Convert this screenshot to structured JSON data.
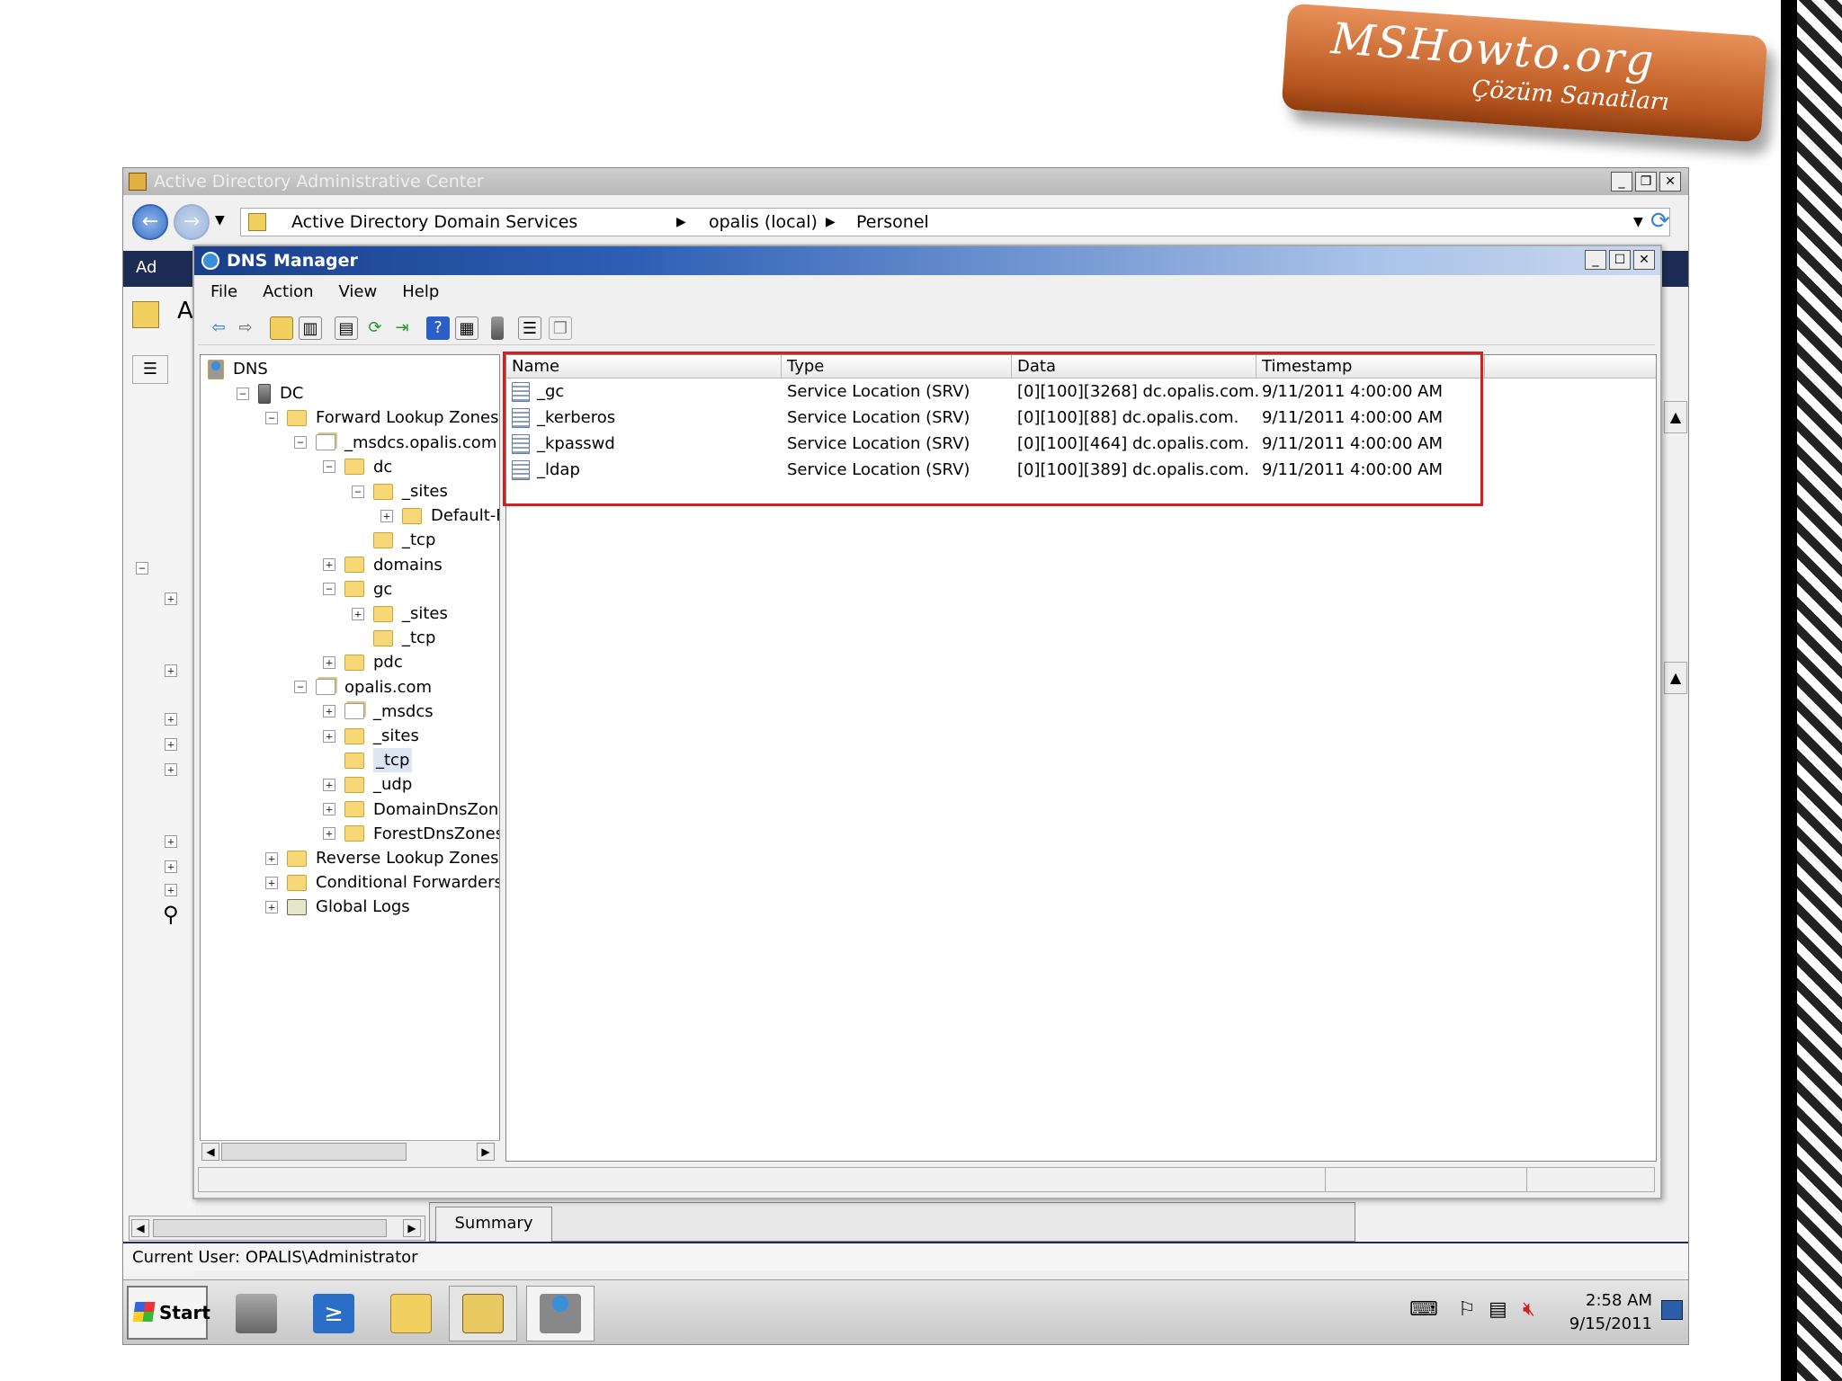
{
  "logo": {
    "title": "MSHowto.org",
    "subtitle": "Çözüm Sanatları"
  },
  "adac": {
    "window_title": "Active Directory Administrative Center",
    "breadcrumb": [
      "Active Directory Domain Services",
      "opalis (local)",
      "Personel"
    ],
    "side_label_1": "Ad",
    "side_label_2": "A",
    "summary_tab": "Summary",
    "current_user": "Current User: OPALIS\\Administrator"
  },
  "dns": {
    "window_title": "DNS Manager",
    "menu": [
      "File",
      "Action",
      "View",
      "Help"
    ],
    "tree": [
      {
        "label": "DNS",
        "level": 0,
        "icon": "dns-server-icon",
        "exp": ""
      },
      {
        "label": "DC",
        "level": 1,
        "icon": "server-icon",
        "exp": "−"
      },
      {
        "label": "Forward Lookup Zones",
        "level": 2,
        "icon": "folder-icon",
        "exp": "−"
      },
      {
        "label": "_msdcs.opalis.com",
        "level": 3,
        "icon": "zone-icon",
        "exp": "−"
      },
      {
        "label": "dc",
        "level": 4,
        "icon": "folder-icon",
        "exp": "−"
      },
      {
        "label": "_sites",
        "level": 5,
        "icon": "folder-icon",
        "exp": "−"
      },
      {
        "label": "Default-Firs",
        "level": 6,
        "icon": "folder-icon",
        "exp": "+"
      },
      {
        "label": "_tcp",
        "level": 5,
        "icon": "folder-icon",
        "exp": " "
      },
      {
        "label": "domains",
        "level": 4,
        "icon": "folder-icon",
        "exp": "+"
      },
      {
        "label": "gc",
        "level": 4,
        "icon": "folder-icon",
        "exp": "−"
      },
      {
        "label": "_sites",
        "level": 5,
        "icon": "folder-icon",
        "exp": "+"
      },
      {
        "label": "_tcp",
        "level": 5,
        "icon": "folder-icon",
        "exp": " "
      },
      {
        "label": "pdc",
        "level": 4,
        "icon": "folder-icon",
        "exp": "+"
      },
      {
        "label": "opalis.com",
        "level": 3,
        "icon": "zone-icon",
        "exp": "−"
      },
      {
        "label": "_msdcs",
        "level": 4,
        "icon": "zone-icon",
        "exp": "+"
      },
      {
        "label": "_sites",
        "level": 4,
        "icon": "folder-icon",
        "exp": "+"
      },
      {
        "label": "_tcp",
        "level": 4,
        "icon": "folder-icon",
        "exp": " ",
        "selected": true
      },
      {
        "label": "_udp",
        "level": 4,
        "icon": "folder-icon",
        "exp": "+"
      },
      {
        "label": "DomainDnsZones",
        "level": 4,
        "icon": "folder-icon",
        "exp": "+"
      },
      {
        "label": "ForestDnsZones",
        "level": 4,
        "icon": "folder-icon",
        "exp": "+"
      },
      {
        "label": "Reverse Lookup Zones",
        "level": 2,
        "icon": "folder-icon",
        "exp": "+"
      },
      {
        "label": "Conditional Forwarders",
        "level": 2,
        "icon": "folder-icon",
        "exp": "+"
      },
      {
        "label": "Global Logs",
        "level": 2,
        "icon": "logs-icon",
        "exp": "+"
      }
    ],
    "columns": [
      "Name",
      "Type",
      "Data",
      "Timestamp"
    ],
    "records": [
      {
        "name": "_gc",
        "type": "Service Location (SRV)",
        "data": "[0][100][3268] dc.opalis.com.",
        "timestamp": "9/11/2011 4:00:00 AM"
      },
      {
        "name": "_kerberos",
        "type": "Service Location (SRV)",
        "data": "[0][100][88] dc.opalis.com.",
        "timestamp": "9/11/2011 4:00:00 AM"
      },
      {
        "name": "_kpasswd",
        "type": "Service Location (SRV)",
        "data": "[0][100][464] dc.opalis.com.",
        "timestamp": "9/11/2011 4:00:00 AM"
      },
      {
        "name": "_ldap",
        "type": "Service Location (SRV)",
        "data": "[0][100][389] dc.opalis.com.",
        "timestamp": "9/11/2011 4:00:00 AM"
      }
    ]
  },
  "taskbar": {
    "start": "Start",
    "time": "2:58 AM",
    "date": "9/15/2011"
  },
  "colors": {
    "highlight": "#d42020",
    "title_blue": "#1a3f8a"
  }
}
